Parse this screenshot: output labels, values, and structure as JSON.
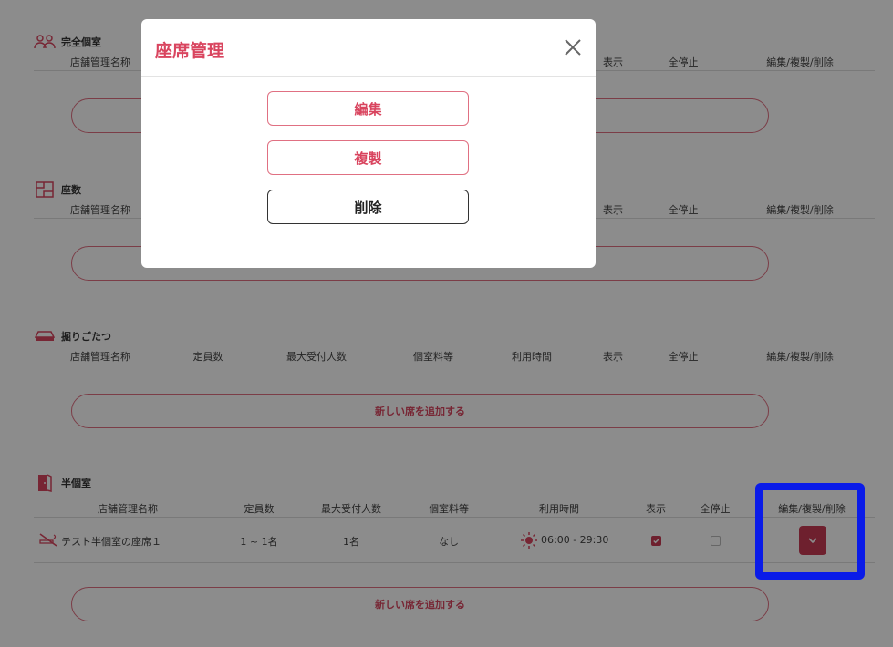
{
  "columns": [
    "店舗管理名称",
    "定員数",
    "最大受付人数",
    "個室料等",
    "利用時間",
    "表示",
    "全停止",
    "編集/複製/削除"
  ],
  "columns_partial": [
    "表示",
    "全停止",
    "編集/複製/削除"
  ],
  "sections": [
    {
      "title": "完全個室",
      "icon": "people-icon"
    },
    {
      "title": "座数",
      "icon": "floorplan-icon"
    },
    {
      "title": "掘りごたつ",
      "icon": "kotatsu-icon",
      "add_label": "新しい席を追加する"
    },
    {
      "title": "半個室",
      "icon": "door-icon",
      "add_label": "新しい席を追加する"
    }
  ],
  "row": {
    "name": "テスト半個室の座席１",
    "capacity": "1 ~ 1名",
    "max_guests": "1名",
    "room_fee": "なし",
    "time": "06:00 - 29:30",
    "display_checked": true,
    "stop_checked": false
  },
  "modal": {
    "title": "座席管理",
    "edit_label": "編集",
    "copy_label": "複製",
    "delete_label": "削除"
  },
  "colors": {
    "accent": "#d9455f",
    "highlight": "#0a1be8"
  }
}
